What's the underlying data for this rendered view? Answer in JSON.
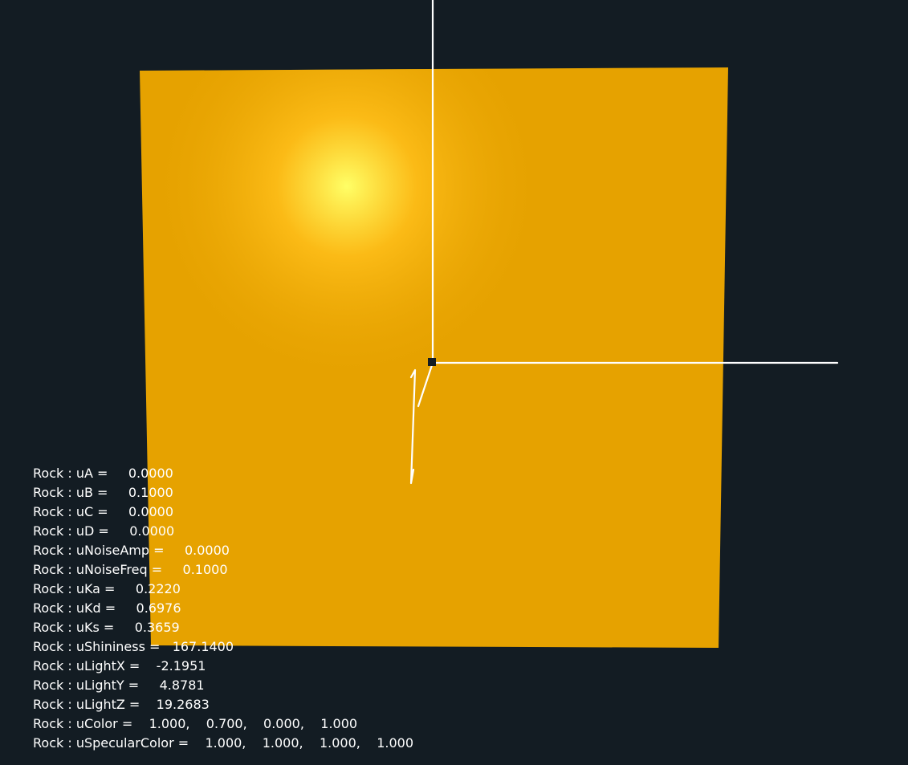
{
  "colors": {
    "background": "#131c23",
    "surface_base": "#e6a200",
    "highlight_core": "#ffff66",
    "highlight_mid": "#ffbf1a",
    "axes": "#ffffff",
    "text": "#ffffff"
  },
  "params": [
    {
      "label": "Rock : uA = ",
      "value": "    0.0000"
    },
    {
      "label": "Rock : uB = ",
      "value": "    0.1000"
    },
    {
      "label": "Rock : uC = ",
      "value": "    0.0000"
    },
    {
      "label": "Rock : uD = ",
      "value": "    0.0000"
    },
    {
      "label": "Rock : uNoiseAmp = ",
      "value": "    0.0000"
    },
    {
      "label": "Rock : uNoiseFreq = ",
      "value": "    0.1000"
    },
    {
      "label": "Rock : uKa = ",
      "value": "    0.2220"
    },
    {
      "label": "Rock : uKd = ",
      "value": "    0.6976"
    },
    {
      "label": "Rock : uKs = ",
      "value": "    0.3659"
    },
    {
      "label": "Rock : uShininess = ",
      "value": "  167.1400"
    },
    {
      "label": "Rock : uLightX = ",
      "value": "   -2.1951"
    },
    {
      "label": "Rock : uLightY = ",
      "value": "    4.8781"
    },
    {
      "label": "Rock : uLightZ = ",
      "value": "   19.2683"
    },
    {
      "label": "Rock : uColor = ",
      "value": "   1.000,    0.700,    0.000,    1.000"
    },
    {
      "label": "Rock : uSpecularColor = ",
      "value": "   1.000,    1.000,    1.000,    1.000"
    }
  ]
}
